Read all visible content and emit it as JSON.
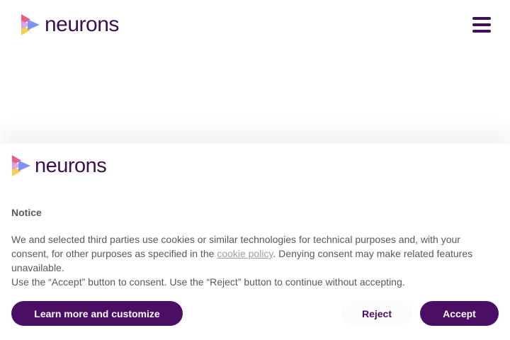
{
  "header": {
    "logo_text": "neurons",
    "menu_icon": "hamburger-menu-icon"
  },
  "banner": {
    "logo_text": "neurons",
    "notice_title": "Notice",
    "body_part1": "We and selected third parties use cookies or similar technologies for technical purposes and, with your consent, for other purposes as specified in the ",
    "cookie_link": "cookie policy",
    "body_part2": ". Denying consent may make related features unavailable.",
    "body_line2": "Use the “Accept” button to consent. Use the “Reject” button to continue without accepting.",
    "learn_more_label": "Learn more and customize",
    "reject_label": "Reject",
    "accept_label": "Accept"
  },
  "colors": {
    "brand_purple": "#3c1053",
    "button_purple": "#4a0f64",
    "body_text": "#595959",
    "logo_pink": "#ee5c8e",
    "logo_blue": "#7b8cf0",
    "logo_yellow": "#f5cf54"
  }
}
